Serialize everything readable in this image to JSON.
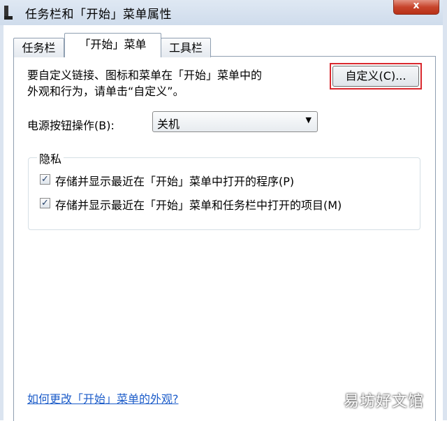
{
  "window": {
    "title": "任务栏和「开始」菜单属性",
    "close_symbol": "x"
  },
  "tabs": [
    {
      "label": "任务栏",
      "active": false
    },
    {
      "label": "「开始」菜单",
      "active": true
    },
    {
      "label": "工具栏",
      "active": false
    }
  ],
  "start_menu": {
    "description_line1": "要自定义链接、图标和菜单在「开始」菜单中的",
    "description_line2": "外观和行为，请单击“自定义”。",
    "customize_button": "自定义(C)...",
    "power_button_label": "电源按钮操作(B):",
    "power_button_value": "关机",
    "privacy": {
      "title": "隐私",
      "options": [
        {
          "label": "存储并显示最近在「开始」菜单中打开的程序(P)",
          "checked": true
        },
        {
          "label": "存储并显示最近在「开始」菜单和任务栏中打开的项目(M)",
          "checked": true
        }
      ]
    },
    "help_link": "如何更改「开始」菜单的外观?"
  },
  "watermark": "易坊好文馆",
  "colors": {
    "highlight_border": "#d9282e",
    "link": "#1c5cc9",
    "close_button": "#c7442c"
  }
}
